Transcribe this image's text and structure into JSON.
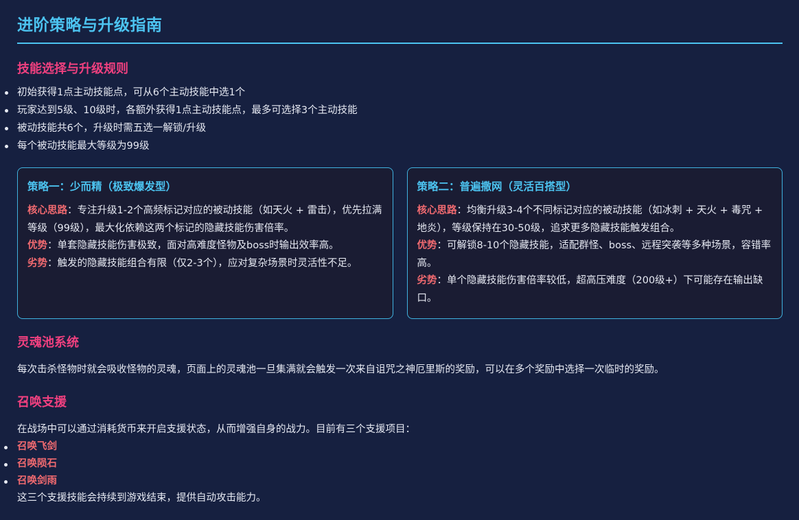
{
  "title": "进阶策略与升级指南",
  "skills": {
    "heading": "技能选择与升级规则",
    "rules": [
      "初始获得1点主动技能点，可从6个主动技能中选1个",
      "玩家达到5级、10级时，各额外获得1点主动技能点，最多可选择3个主动技能",
      "被动技能共6个，升级时需五选一解锁/升级",
      "每个被动技能最大等级为99级"
    ]
  },
  "strategies": [
    {
      "title": "策略一：少而精（极致爆发型）",
      "core_label": "核心思路",
      "core_text": "：专注升级1-2个高频标记对应的被动技能（如天火 + 雷击），优先拉满等级（99级），最大化依赖这两个标记的隐藏技能伤害倍率。",
      "pros_label": "优势",
      "pros_text": "：单套隐藏技能伤害极致，面对高难度怪物及boss时输出效率高。",
      "cons_label": "劣势",
      "cons_text": "：触发的隐藏技能组合有限（仅2-3个），应对复杂场景时灵活性不足。"
    },
    {
      "title": "策略二：普遍撒网（灵活百搭型）",
      "core_label": "核心思路",
      "core_text": "：均衡升级3-4个不同标记对应的被动技能（如冰刺 + 天火 + 毒咒 + 地炎），等级保持在30-50级，追求更多隐藏技能触发组合。",
      "pros_label": "优势",
      "pros_text": "：可解锁8-10个隐藏技能，适配群怪、boss、远程突袭等多种场景，容错率高。",
      "cons_label": "劣势",
      "cons_text": "：单个隐藏技能伤害倍率较低，超高压难度（200级+）下可能存在输出缺口。"
    }
  ],
  "soul_pool": {
    "heading": "灵魂池系统",
    "text": "每次击杀怪物时就会吸收怪物的灵魂，页面上的灵魂池一旦集满就会触发一次来自诅咒之神厄里斯的奖励，可以在多个奖励中选择一次临时的奖励。"
  },
  "summon": {
    "heading": "召唤支援",
    "intro": "在战场中可以通过消耗货币来开启支援状态，从而增强自身的战力。目前有三个支援项目：",
    "items": [
      "召唤飞剑",
      "召唤陨石",
      "召唤剑雨"
    ],
    "outro": "这三个支援技能会持续到游戏结束，提供自动攻击能力。"
  }
}
